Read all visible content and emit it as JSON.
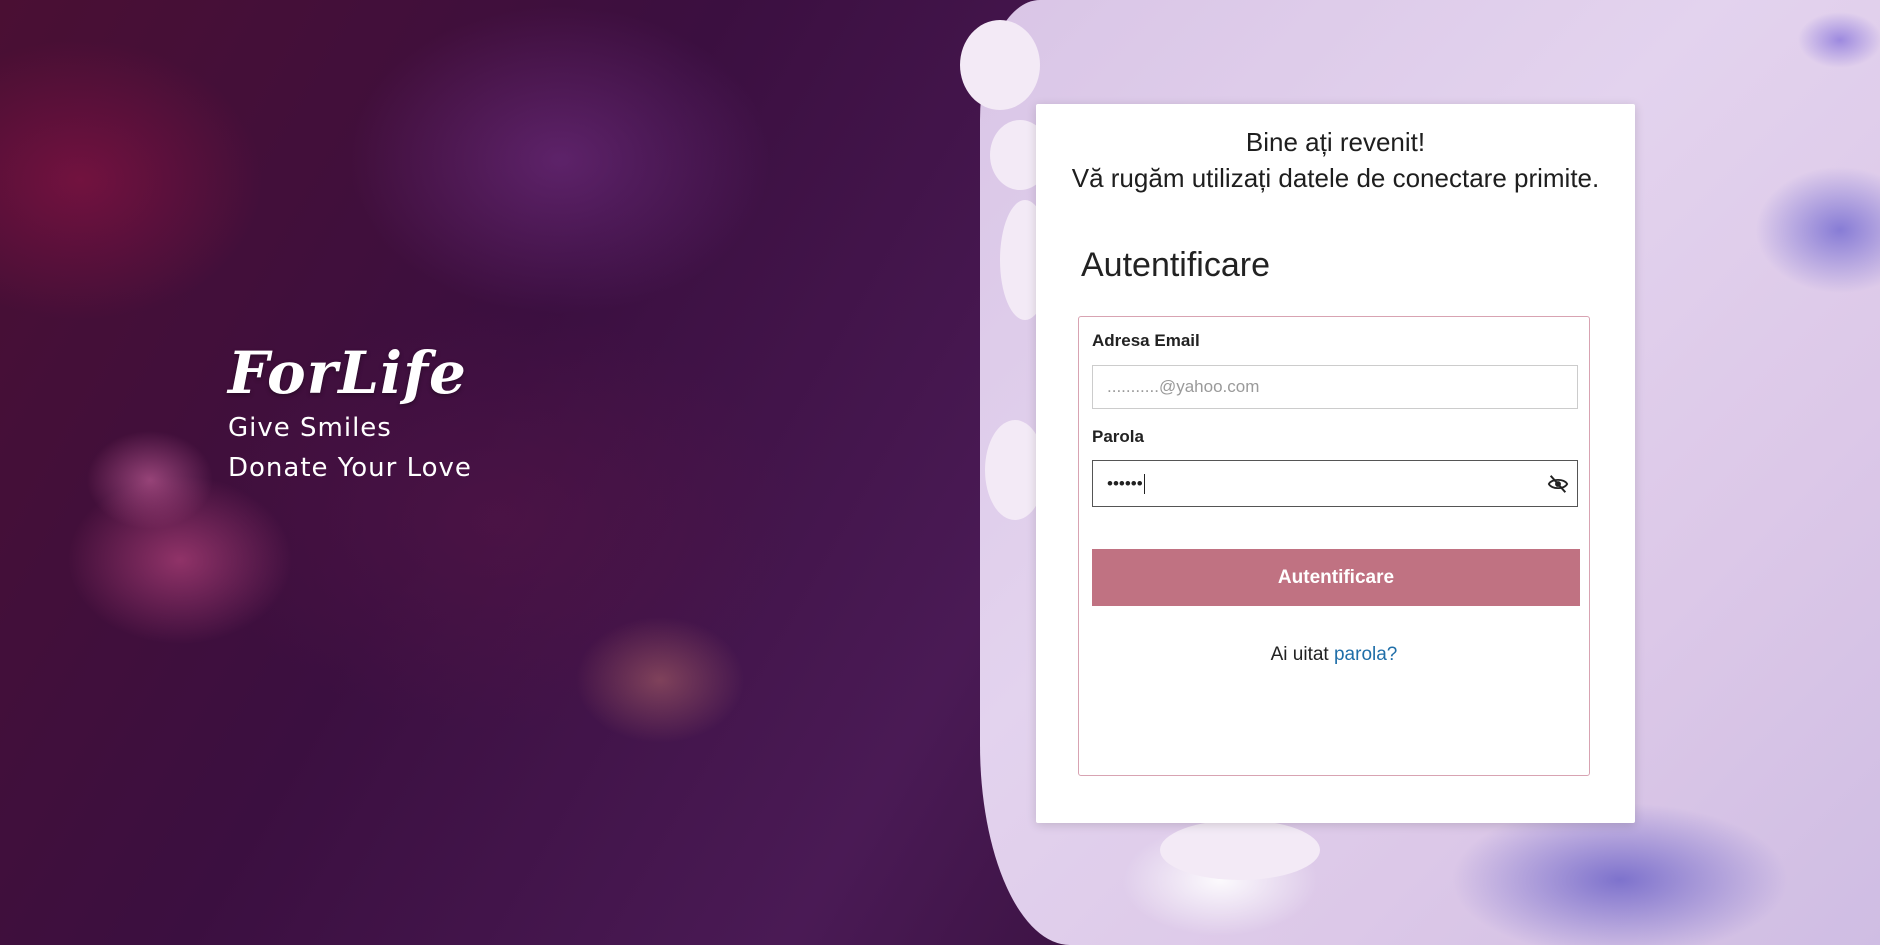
{
  "brand": {
    "logo": "ForLife",
    "tagline_line1": "Give Smiles",
    "tagline_line2": "Donate Your Love"
  },
  "card": {
    "welcome_line1": "Bine ați revenit!",
    "welcome_line2": "Vă rugăm utilizați datele de conectare primite.",
    "title": "Autentificare"
  },
  "form": {
    "email_label": "Adresa Email",
    "email_value": "...........@yahoo.com",
    "password_label": "Parola",
    "password_value": "••••••",
    "submit_label": "Autentificare",
    "forgot_prefix": "Ai uitat",
    "forgot_link": "parola?"
  },
  "icons": {
    "password_toggle": "eye-slash-icon"
  },
  "colors": {
    "button": "#c07282",
    "link": "#1f6ea8",
    "form_border": "#d8a3b2"
  }
}
